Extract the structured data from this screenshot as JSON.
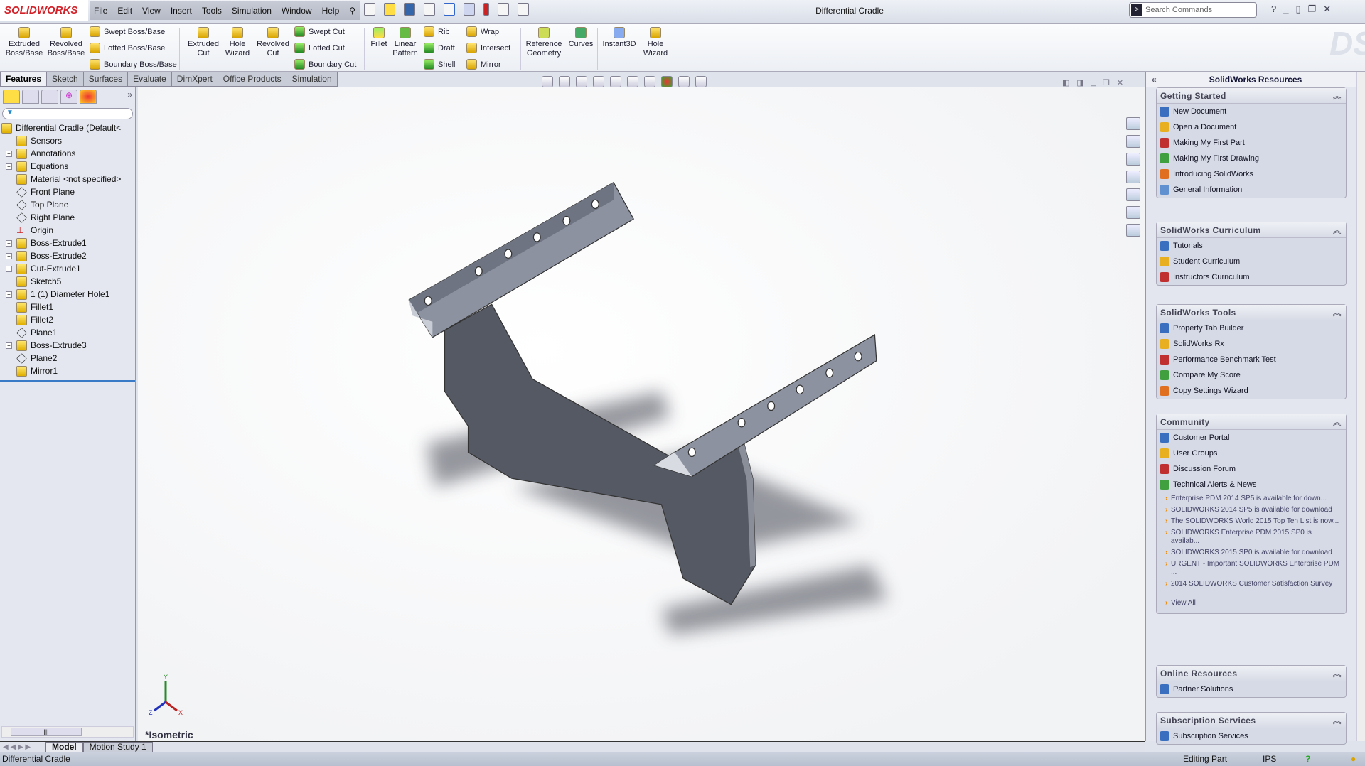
{
  "app": {
    "brand": "SOLIDWORKS",
    "title": "Differential Cradle",
    "search_placeholder": "Search Commands"
  },
  "menu": [
    "File",
    "Edit",
    "View",
    "Insert",
    "Tools",
    "Simulation",
    "Window",
    "Help"
  ],
  "ribbon": {
    "extruded_boss": "Extruded Boss/Base",
    "revolved_boss": "Revolved Boss/Base",
    "swept_boss": "Swept Boss/Base",
    "lofted_boss": "Lofted Boss/Base",
    "boundary_boss": "Boundary Boss/Base",
    "extruded_cut": "Extruded Cut",
    "hole_wizard": "Hole Wizard",
    "revolved_cut": "Revolved Cut",
    "swept_cut": "Swept Cut",
    "lofted_cut": "Lofted Cut",
    "boundary_cut": "Boundary Cut",
    "fillet": "Fillet",
    "linear_pattern": "Linear Pattern",
    "rib": "Rib",
    "draft": "Draft",
    "shell": "Shell",
    "wrap": "Wrap",
    "intersect": "Intersect",
    "mirror": "Mirror",
    "reference_geometry": "Reference Geometry",
    "curves": "Curves",
    "instant3d": "Instant3D",
    "hole_wizard2": "Hole Wizard"
  },
  "tabs": [
    "Features",
    "Sketch",
    "Surfaces",
    "Evaluate",
    "DimXpert",
    "Office Products",
    "Simulation"
  ],
  "tree": [
    {
      "label": "Differential Cradle  (Default<",
      "exp": false
    },
    {
      "label": "Sensors",
      "exp": false
    },
    {
      "label": "Annotations",
      "exp": true
    },
    {
      "label": "Equations",
      "exp": true
    },
    {
      "label": "Material <not specified>",
      "exp": false
    },
    {
      "label": "Front Plane",
      "exp": false
    },
    {
      "label": "Top Plane",
      "exp": false
    },
    {
      "label": "Right Plane",
      "exp": false
    },
    {
      "label": "Origin",
      "exp": false
    },
    {
      "label": "Boss-Extrude1",
      "exp": true
    },
    {
      "label": "Boss-Extrude2",
      "exp": true
    },
    {
      "label": "Cut-Extrude1",
      "exp": true
    },
    {
      "label": "Sketch5",
      "exp": false
    },
    {
      "label": "1 (1) Diameter Hole1",
      "exp": true
    },
    {
      "label": "Fillet1",
      "exp": false
    },
    {
      "label": "Fillet2",
      "exp": false
    },
    {
      "label": "Plane1",
      "exp": false
    },
    {
      "label": "Boss-Extrude3",
      "exp": true
    },
    {
      "label": "Plane2",
      "exp": false
    },
    {
      "label": "Mirror1",
      "exp": false
    }
  ],
  "viewport": {
    "view_label": "*Isometric",
    "axes": [
      "X",
      "Y",
      "Z"
    ]
  },
  "resources": {
    "title": "SolidWorks Resources",
    "getting_started": {
      "title": "Getting Started",
      "items": [
        "New Document",
        "Open a Document",
        "Making My First Part",
        "Making My First Drawing",
        "Introducing SolidWorks",
        "General Information"
      ]
    },
    "curriculum": {
      "title": "SolidWorks Curriculum",
      "items": [
        "Tutorials",
        "Student Curriculum",
        "Instructors Curriculum"
      ]
    },
    "tools": {
      "title": "SolidWorks Tools",
      "items": [
        "Property Tab Builder",
        "SolidWorks Rx",
        "Performance Benchmark Test",
        "Compare My Score",
        "Copy Settings Wizard"
      ]
    },
    "community": {
      "title": "Community",
      "items": [
        "Customer Portal",
        "User Groups",
        "Discussion Forum",
        "Technical Alerts & News"
      ],
      "news": [
        "Enterprise PDM 2014 SP5 is available for down...",
        "SOLIDWORKS 2014 SP5 is available for download",
        "The SOLIDWORKS World 2015 Top Ten List is now...",
        "SOLIDWORKS Enterprise PDM 2015 SP0 is availab...",
        "SOLIDWORKS 2015 SP0 is available for download",
        "URGENT - Important SOLIDWORKS Enterprise PDM ...",
        "2014 SOLIDWORKS Customer Satisfaction Survey"
      ],
      "view_all": "View All"
    },
    "online": {
      "title": "Online Resources",
      "items": [
        "Partner Solutions"
      ]
    },
    "subscription": {
      "title": "Subscription Services",
      "items": [
        "Subscription Services"
      ]
    }
  },
  "bottom_tabs": [
    "Model",
    "Motion Study 1"
  ],
  "status": {
    "left": "Differential Cradle",
    "mode": "Editing Part",
    "units": "IPS"
  },
  "colors": {
    "brand": "#d2232a",
    "part": "#565a66",
    "accent": "#3a7bc8"
  }
}
